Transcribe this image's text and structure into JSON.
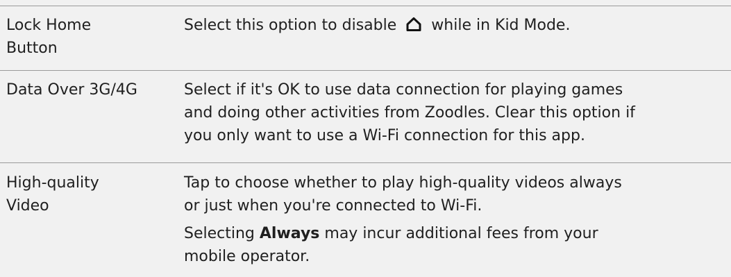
{
  "rows": [
    {
      "label": [
        "Lock Home",
        "Button"
      ],
      "desc_before_icon": "Select this option to disable",
      "desc_icon": "home-icon",
      "desc_after_icon": "while in Kid Mode."
    },
    {
      "label": [
        "Data Over 3G/4G"
      ],
      "desc_lines": [
        "Select if it's OK to use data connection for playing games",
        "and doing other activities from Zoodles. Clear this option if",
        "you only want to use a Wi-Fi connection for this app."
      ]
    },
    {
      "label": [
        "High-quality",
        "Video"
      ],
      "desc_lines": [
        "Tap to choose whether to play high-quality videos always",
        "or just when you're connected to Wi-Fi."
      ],
      "note_prefix": "Selecting",
      "note_bold": "Always",
      "note_line1_rest": "may incur additional fees from your",
      "note_line2": "mobile operator."
    }
  ]
}
